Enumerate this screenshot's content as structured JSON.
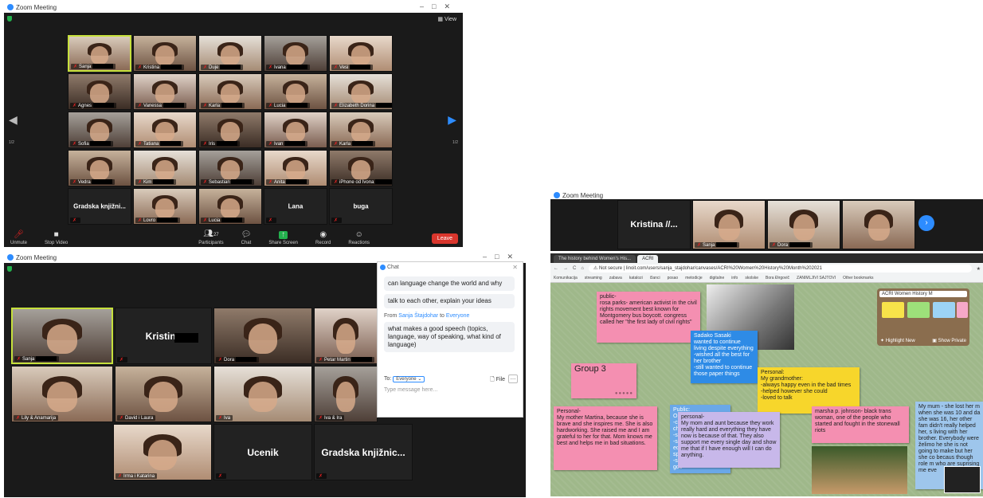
{
  "window1": {
    "title": "Zoom Meeting",
    "view_label": "View",
    "page_left": "1/2",
    "page_right": "1/2",
    "tiles": [
      {
        "name": "Sanja",
        "redacted": true
      },
      {
        "name": "Kristina",
        "redacted": true
      },
      {
        "name": "Duje",
        "redacted": true
      },
      {
        "name": "Ivana",
        "redacted": true
      },
      {
        "name": "Vesi",
        "redacted": true
      },
      {
        "name": "Agnes",
        "redacted": true
      },
      {
        "name": "Vanessa",
        "redacted": true
      },
      {
        "name": "Karla",
        "redacted": true
      },
      {
        "name": "Lucia",
        "redacted": true
      },
      {
        "name": "Elizabeth Dorina",
        "redacted": true
      },
      {
        "name": "Sofia",
        "redacted": true
      },
      {
        "name": "Tatiana",
        "redacted": true
      },
      {
        "name": "Iris",
        "redacted": true
      },
      {
        "name": "Ivan",
        "redacted": true
      },
      {
        "name": "Karla",
        "redacted": true
      },
      {
        "name": "Vedra",
        "redacted": true
      },
      {
        "name": "Kim",
        "redacted": true
      },
      {
        "name": "Sebastian",
        "redacted": true
      },
      {
        "name": "Anita",
        "redacted": true
      },
      {
        "name": "iPhone od Ivona",
        "redacted": true
      },
      {
        "name": "Gradska knjižni...",
        "redacted": false
      },
      {
        "name": "Lovro",
        "redacted": true
      },
      {
        "name": "Lucia",
        "redacted": true
      },
      {
        "name": "Lana",
        "redacted": false
      },
      {
        "name": "buga",
        "redacted": false
      }
    ],
    "toolbar": {
      "unmute": "Unmute",
      "stop_video": "Stop Video",
      "participants": "Participants",
      "participants_count": "27",
      "chat": "Chat",
      "share_screen": "Share Screen",
      "record": "Record",
      "reactions": "Reactions",
      "leave": "Leave"
    }
  },
  "window2": {
    "title": "Zoom Meeting",
    "tiles": [
      {
        "name": "Sanja",
        "redacted": true
      },
      {
        "name": "Kristina",
        "redacted": false,
        "big": true
      },
      {
        "name": "Dora",
        "redacted": true
      },
      {
        "name": "Petar Martin",
        "redacted": true
      },
      {
        "name": "Lily & Anamarija",
        "redacted": false
      },
      {
        "name": "David i Laura",
        "redacted": false
      },
      {
        "name": "Iva",
        "redacted": false
      },
      {
        "name": "Iva & Ira",
        "redacted": false
      },
      {
        "name": "Irma i Katarina",
        "redacted": false
      },
      {
        "name": "Ucenik",
        "redacted": false
      },
      {
        "name": "Gradska knjižnic...",
        "redacted": false
      }
    ],
    "chat": {
      "header": "Chat",
      "messages": [
        "can language change the world and why",
        "talk to each other, explain your ideas"
      ],
      "from_prefix": "From",
      "from_name": "Sanja Štajdohar",
      "to_word": "to",
      "to_target": "Everyone",
      "last_message": "what makes a good speech (topics, language, way of speaking, what kind of language)",
      "to_label": "To:",
      "to_select": "Everyone",
      "file_label": "File",
      "placeholder": "Type message here..."
    }
  },
  "window3": {
    "title": "Zoom Meeting",
    "tiles": [
      {
        "name": "Kristina //...",
        "redacted": false
      },
      {
        "name": "Sanja",
        "redacted": true
      },
      {
        "name": "Dora",
        "redacted": true
      },
      {
        "name": "",
        "redacted": false
      }
    ],
    "browser": {
      "tabs": [
        "The history behind Women's His...",
        "ACRI"
      ],
      "url_prefix": "Not secure",
      "url": "linoit.com/users/sanja_stajdohar/canvases/ACRI%20Women%20History%20Month%202021",
      "bookmarks": [
        "Komunikacija",
        "streaming",
        "zabava",
        "katalozi",
        "članci",
        "posao",
        "metodicje",
        "digitalne",
        "info",
        "skolske",
        "Bora Đirgovič",
        "ZANIMLJIVI SAJTOVI",
        "Other bookmarks"
      ]
    },
    "panel_title": "ACRI Women History M",
    "panel_highlight": "Highlight New",
    "panel_show": "Show Private",
    "notes": [
      {
        "id": "rosa",
        "text": "public-\nrosa parks- american activist in the civil rights movement best known for Montgomery bus boycott. congress called her \"the first lady of civil rights\""
      },
      {
        "id": "sadako",
        "text": "Sadako Sasaki\nwanted to continue living despite everything\n-wished all the best for her brother\n-still wanted to continue those paper things"
      },
      {
        "id": "group3",
        "text": "Group 3"
      },
      {
        "id": "grandmother",
        "text": "Personal:\nMy grandmother:\n-always happy even in the bad times\n-helped however she could\n-loved to talk"
      },
      {
        "id": "martina",
        "text": "Personal-\nMy mother Martina, because she is brave and she inspires me. She is also hardworking. She raised me and I am grateful to her for that. Mom knows me best and helps me in bad situations."
      },
      {
        "id": "public2",
        "text": "Public:\nOpr\n-clo\nchil\n-sh\n-sh\nedu\nspe\n-sh\ngoo"
      },
      {
        "id": "momaunt",
        "text": "personal-\nMy mom and aunt because they work really hard and everything they have now is because of that. They also support me every single day and show me that if I have enough will I can do anything."
      },
      {
        "id": "marsha",
        "text": "marsha p. johnson- black trans woman, one of the people who started and fought in the stonewall riots"
      },
      {
        "id": "mymum",
        "text": "My mum - she lost her m when she was 10 and da she was 16, her other fam didn't really helped her, s living with her brother. Everybody were želimo he she is not going to make but her she co becaus though role m who are suprising me eve"
      }
    ]
  }
}
